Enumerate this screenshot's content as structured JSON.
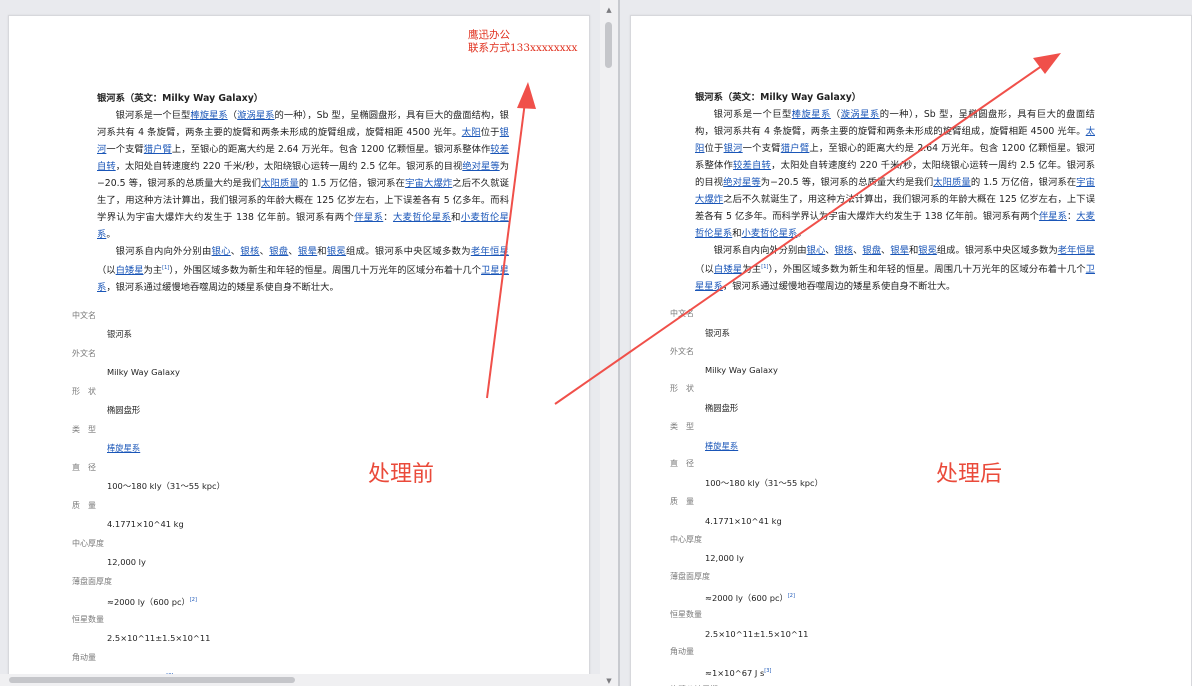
{
  "watermark": {
    "line1": "鹰迅办公",
    "line2": "联系方式133xxxxxxxx"
  },
  "labels": {
    "before": "处理前",
    "after": "处理后"
  },
  "doc": {
    "title": "银河系（英文：Milky Way Galaxy）",
    "p1": [
      {
        "t": "银河系是一个巨型"
      },
      {
        "t": "棒旋星系",
        "l": 1
      },
      {
        "t": "（"
      },
      {
        "t": "漩涡星系",
        "l": 1
      },
      {
        "t": "的一种），Sb 型，呈椭圆盘形，具有巨大的盘面结构，银河系共有 4 条旋臂，两条主要的旋臂和两条未形成的旋臂组成，旋臂相距 4500 光年。"
      },
      {
        "t": "太阳",
        "l": 1
      },
      {
        "t": "位于"
      },
      {
        "t": "银河",
        "l": 1
      },
      {
        "t": "一个支臂"
      },
      {
        "t": "猎户臂",
        "l": 1
      },
      {
        "t": "上，至银心的距离大约是 2.64 万光年。包含 1200 亿颗恒星。银河系整体作"
      },
      {
        "t": "较差自转",
        "l": 1
      },
      {
        "t": "，太阳处自转速度约 220 千米/秒，太阳绕银心运转一周约 2.5 亿年。银河系的目视"
      },
      {
        "t": "绝对星等",
        "l": 1
      },
      {
        "t": "为−20.5 等，银河系的总质量大约是我们"
      },
      {
        "t": "太阳质量",
        "l": 1
      },
      {
        "t": "的 1.5 万亿倍，银河系在"
      },
      {
        "t": "宇宙大爆炸",
        "l": 1
      },
      {
        "t": "之后不久就诞生了，用这种方法计算出，我们银河系的年龄大概在 125 亿岁左右，上下误差各有 5 亿多年。而科学界认为宇宙大爆炸大约发生于 138 亿年前。银河系有两个"
      },
      {
        "t": "伴星系",
        "l": 1
      },
      {
        "t": "："
      },
      {
        "t": "大麦哲伦星系",
        "l": 1
      },
      {
        "t": "和"
      },
      {
        "t": "小麦哲伦星系",
        "l": 1
      },
      {
        "t": "。"
      }
    ],
    "p2": [
      {
        "t": "银河系自内向外分别由"
      },
      {
        "t": "银心",
        "l": 1
      },
      {
        "t": "、"
      },
      {
        "t": "银核",
        "l": 1
      },
      {
        "t": "、"
      },
      {
        "t": "银盘",
        "l": 1
      },
      {
        "t": "、"
      },
      {
        "t": "银晕",
        "l": 1
      },
      {
        "t": "和"
      },
      {
        "t": "银冕",
        "l": 1
      },
      {
        "t": "组成。银河系中央区域多数为"
      },
      {
        "t": "老年恒星",
        "l": 1
      },
      {
        "t": "（以"
      },
      {
        "t": "白矮星",
        "l": 1
      },
      {
        "t": "为主"
      },
      {
        "t": "[1]",
        "s": 1
      },
      {
        "t": "），外围区域多数为新生和年轻的恒星。周围几十万光年的区域分布着十几个"
      },
      {
        "t": "卫星星系",
        "l": 1
      },
      {
        "t": "，银河系通过缓慢地吞噬周边的矮星系使自身不断壮大。"
      }
    ],
    "props": [
      {
        "label": "中文名",
        "value": "银河系"
      },
      {
        "label": "外文名",
        "value": "Milky Way Galaxy"
      },
      {
        "label": "形　状",
        "value": "椭圆盘形"
      },
      {
        "label": "类　型",
        "value": "棒旋星系",
        "link": true
      },
      {
        "label": "直　径",
        "value": "100～180 kly（31～55 kpc）"
      },
      {
        "label": "质　量",
        "value": "4.1771×10^41 kg"
      },
      {
        "label": "中心厚度",
        "value": "12,000 ly"
      },
      {
        "label": "薄盘面厚度",
        "value": "≈2000 ly（600 pc）",
        "ref": "[2]"
      },
      {
        "label": "恒星数量",
        "value": "2.5×10^11±1.5×10^11"
      },
      {
        "label": "角动量",
        "value": "≈1×10^67 J s",
        "ref": "[3]"
      },
      {
        "label": "旋臂公转周期",
        "value": ""
      }
    ]
  },
  "icons": {
    "scroll_up": "▲",
    "scroll_down": "▼"
  },
  "colors": {
    "arrow": "#f0504a",
    "link": "#1a56b8",
    "watermark": "#e0301e"
  }
}
